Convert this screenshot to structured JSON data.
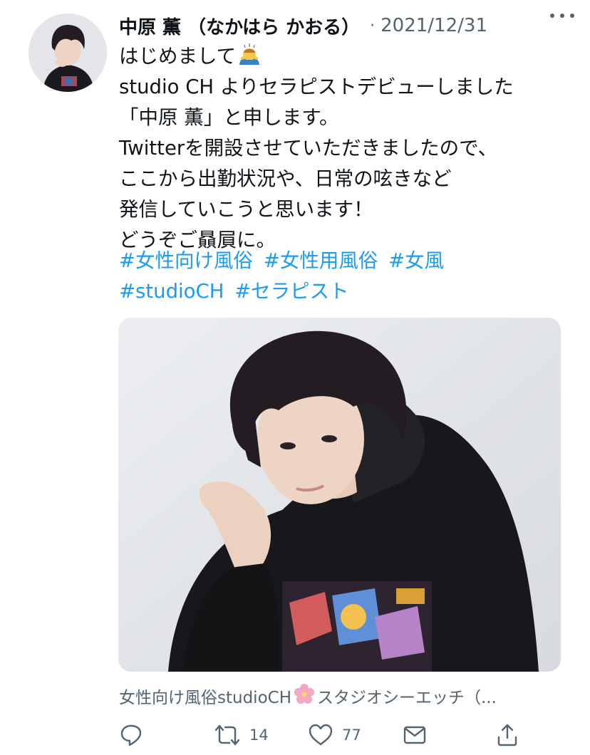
{
  "tweet": {
    "display_name": "中原 薫 （なかはら かおる）",
    "separator": "·",
    "date": "2021/12/31",
    "more_icon": "more-horizontal-icon",
    "text_lines": [
      "はじめまして",
      "studio CH よりセラピストデビューしました",
      "「中原 薫」と申します。",
      "Twitterを開設させていただきましたので、",
      "ここから出勤状況や、日常の呟きなど",
      "発信していこうと思います！",
      "どうぞご贔屓に。"
    ],
    "hashtag_lines": [
      [
        "#女性向け風俗",
        "#女性用風俗",
        "#女風"
      ],
      [
        "#studioCH",
        "#セラピスト"
      ]
    ],
    "link_source_before": "女性向け風俗studioCH",
    "link_source_after": "スタジオシーエッチ（...",
    "actions": {
      "reply_icon": "reply-icon",
      "retweet_icon": "retweet-icon",
      "retweet_count": "14",
      "like_icon": "heart-icon",
      "like_count": "77",
      "dm_icon": "envelope-icon",
      "share_icon": "share-icon"
    },
    "colors": {
      "text": "#0f1419",
      "secondary": "#536471",
      "link": "#1d9bf0"
    }
  }
}
